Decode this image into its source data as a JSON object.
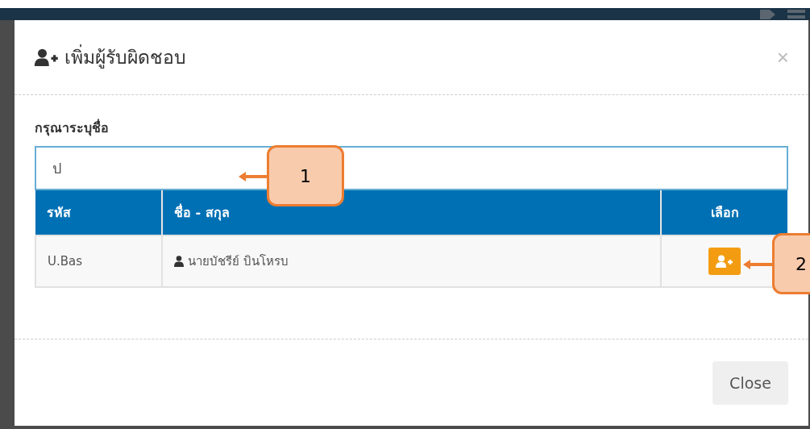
{
  "dialog": {
    "title": "เพิ่มผู้รับผิดชอบ",
    "close_symbol": "×"
  },
  "search": {
    "label": "กรุณาระบุชื่อ",
    "value": "ป"
  },
  "table": {
    "columns": [
      "รหัส",
      "ชื่อ - สกุล",
      "เลือก"
    ],
    "rows": [
      {
        "code": "U.Bas",
        "name": "นายบัชรีย์ บินโหรบ"
      }
    ]
  },
  "footer": {
    "button": "Close"
  },
  "callouts": [
    {
      "text": "1"
    },
    {
      "text": "2"
    }
  ]
}
